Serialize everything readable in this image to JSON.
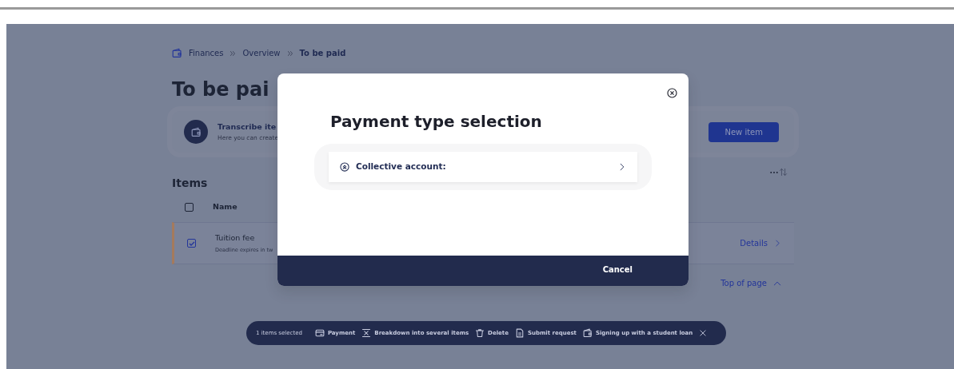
{
  "breadcrumb": [
    {
      "label": "Finances",
      "kind": "link"
    },
    {
      "label": "Overview",
      "kind": "link"
    },
    {
      "label": "To be paid",
      "kind": "current"
    }
  ],
  "page_title": "To be pai",
  "transcribe_card": {
    "title": "Transcribe ite",
    "description": "Here you can create",
    "button": "New item"
  },
  "items_section": {
    "title": "Items",
    "columns": [
      {
        "label": "Name",
        "checked": false
      }
    ],
    "rows": [
      {
        "name": "Tuition fee",
        "subtitle": "Deadline expires in tw",
        "checked": true,
        "selected": true,
        "link": "Details"
      }
    ]
  },
  "top_link": "Top of page",
  "action_bar": {
    "count": "1 items selected",
    "actions": [
      {
        "label": "Payment"
      },
      {
        "label": "Breakdown into several items"
      },
      {
        "label": "Delete"
      },
      {
        "label": "Submit request"
      },
      {
        "label": "Signing up with a student loan"
      }
    ]
  },
  "modal": {
    "title": "Payment type selection",
    "options": [
      {
        "label": "Collective account:"
      }
    ],
    "buttons": [
      "Cancel"
    ]
  }
}
